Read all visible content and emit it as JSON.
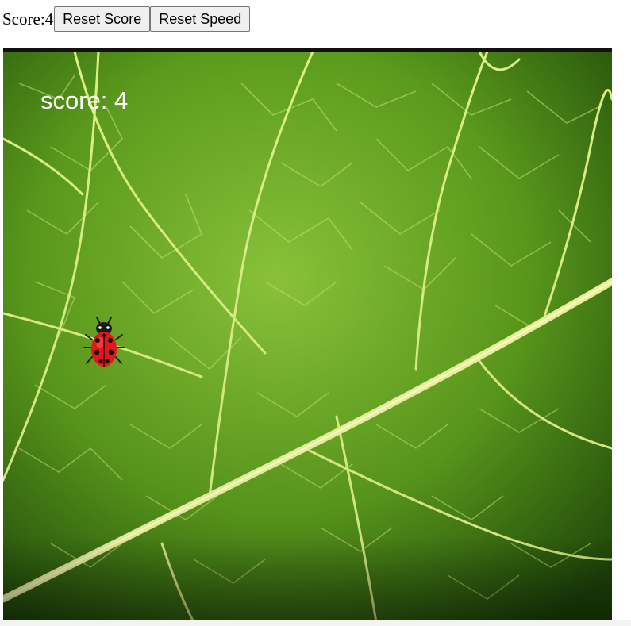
{
  "header": {
    "score_label": "Score:",
    "score_value": "4",
    "reset_score_label": "Reset Score",
    "reset_speed_label": "Reset Speed"
  },
  "game": {
    "canvas_score_text": "score: 4",
    "background": "leaf",
    "sprite": "ladybug",
    "colors": {
      "leaf": "#5c9a1e",
      "vein": "#e3f08c",
      "ladybug": "#e0171c",
      "score_text": "#ffffff"
    }
  }
}
